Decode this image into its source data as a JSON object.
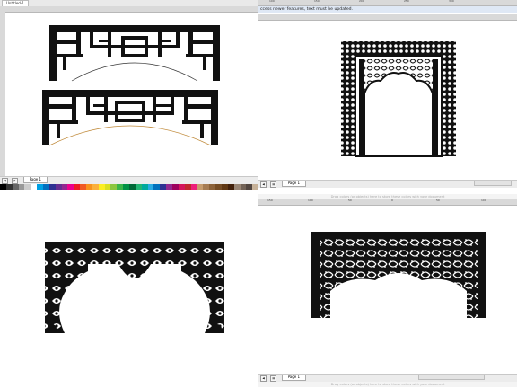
{
  "q1": {
    "window_tab": "Untitled-1",
    "page_tab": "Page 1",
    "palette": [
      "#000000",
      "#333333",
      "#666666",
      "#999999",
      "#cccccc",
      "#ffffff",
      "#00a0e3",
      "#0070c0",
      "#2e3192",
      "#662d91",
      "#92278f",
      "#ec008c",
      "#ed1c24",
      "#f15a24",
      "#f7931e",
      "#fbb03b",
      "#fcee21",
      "#d9e021",
      "#8cc63f",
      "#39b54a",
      "#009245",
      "#006837",
      "#22b573",
      "#00a99d",
      "#29abe2",
      "#0071bc",
      "#2e3192",
      "#93278f",
      "#9e005d",
      "#d4145a",
      "#c1272d",
      "#ed1e79",
      "#c69c6d",
      "#a67c52",
      "#8c6239",
      "#754c24",
      "#603813",
      "#42210b",
      "#998675",
      "#736357",
      "#534741",
      "#c7b299"
    ]
  },
  "q2": {
    "ruler_ticks": [
      "100",
      "150",
      "200",
      "250",
      "300"
    ],
    "info_message": "ccess newer features, text must be updated.",
    "page_tab": "Page 1"
  },
  "q3": {},
  "q4": {
    "ruler_ticks": [
      "150",
      "100",
      "50",
      "0",
      "50",
      "100"
    ],
    "hint_top": "Drag colors (or objects) here to store these colors with your document",
    "page_tab": "Page 1",
    "hint_bottom": "Drag colors (or objects) here to store these colors with your document"
  },
  "colors": {
    "ink": "#111111",
    "guide": "#c08a3a",
    "guide_dark": "#333333"
  }
}
